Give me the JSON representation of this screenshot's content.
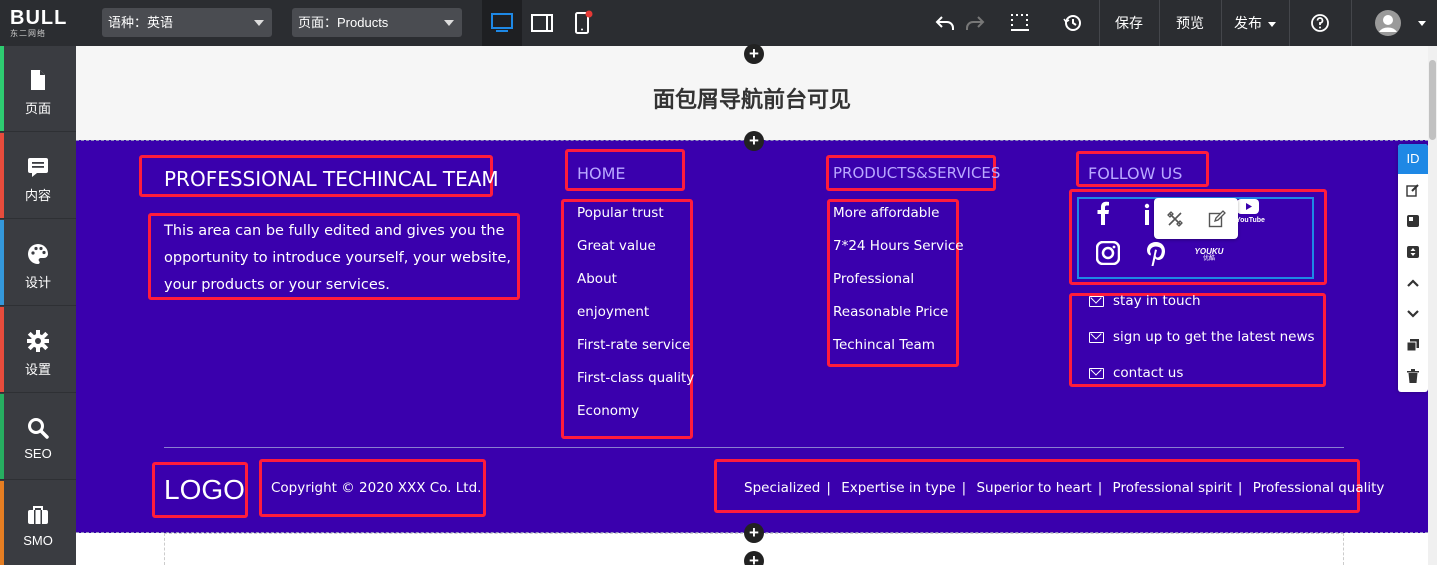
{
  "topbar": {
    "logo_text": "BULL",
    "logo_sub": "东二网络",
    "language_select": "语种：英语",
    "page_select": "页面：Products",
    "save": "保存",
    "preview": "预览",
    "publish": "发布"
  },
  "sidebar": {
    "items": [
      {
        "label": "页面",
        "color": "#2ecc71"
      },
      {
        "label": "内容",
        "color": "#e74c3c"
      },
      {
        "label": "设计",
        "color": "#3498db"
      },
      {
        "label": "设置",
        "color": "#e74c3c"
      },
      {
        "label": "SEO",
        "color": "#27ae60"
      },
      {
        "label": "SMO",
        "color": "#e67e22"
      }
    ]
  },
  "canvas": {
    "breadcrumb_notice": "面包屑导航前台可见"
  },
  "footer": {
    "team_title": "PROFESSIONAL TECHINCAL TEAM",
    "intro": "This area can be fully edited and gives you the opportunity to introduce yourself, your website, your products or your services.",
    "home_title": "HOME",
    "home_links": [
      "Popular trust",
      "Great value",
      "About",
      "enjoyment",
      "First-rate service",
      "First-class quality",
      "Economy"
    ],
    "products_title": "PRODUCTS&SERVICES",
    "products_links": [
      "More affordable",
      "7*24 Hours Service",
      "Professional",
      "Reasonable Price",
      "Techincal Team"
    ],
    "follow_title": "FOLLOW US",
    "social": {
      "youtube_label": "YouTube",
      "youku_label": "YOUKU",
      "youku_sub": "优酷"
    },
    "contact": [
      "stay in touch",
      "sign up to get the latest news",
      "contact us"
    ],
    "logo": "LOGO",
    "copyright": "Copyright © 2020 XXX Co. Ltd.",
    "bottom_links": [
      "Specialized",
      "Expertise in type",
      "Superior to heart",
      "Professional spirit",
      "Professional quality"
    ],
    "bottom_sep": "|"
  },
  "rail": {
    "id_label": "ID"
  },
  "colors": {
    "footer_bg": "#3a00ad",
    "highlight": "#ff1c3c",
    "accent": "#1e88e5"
  }
}
